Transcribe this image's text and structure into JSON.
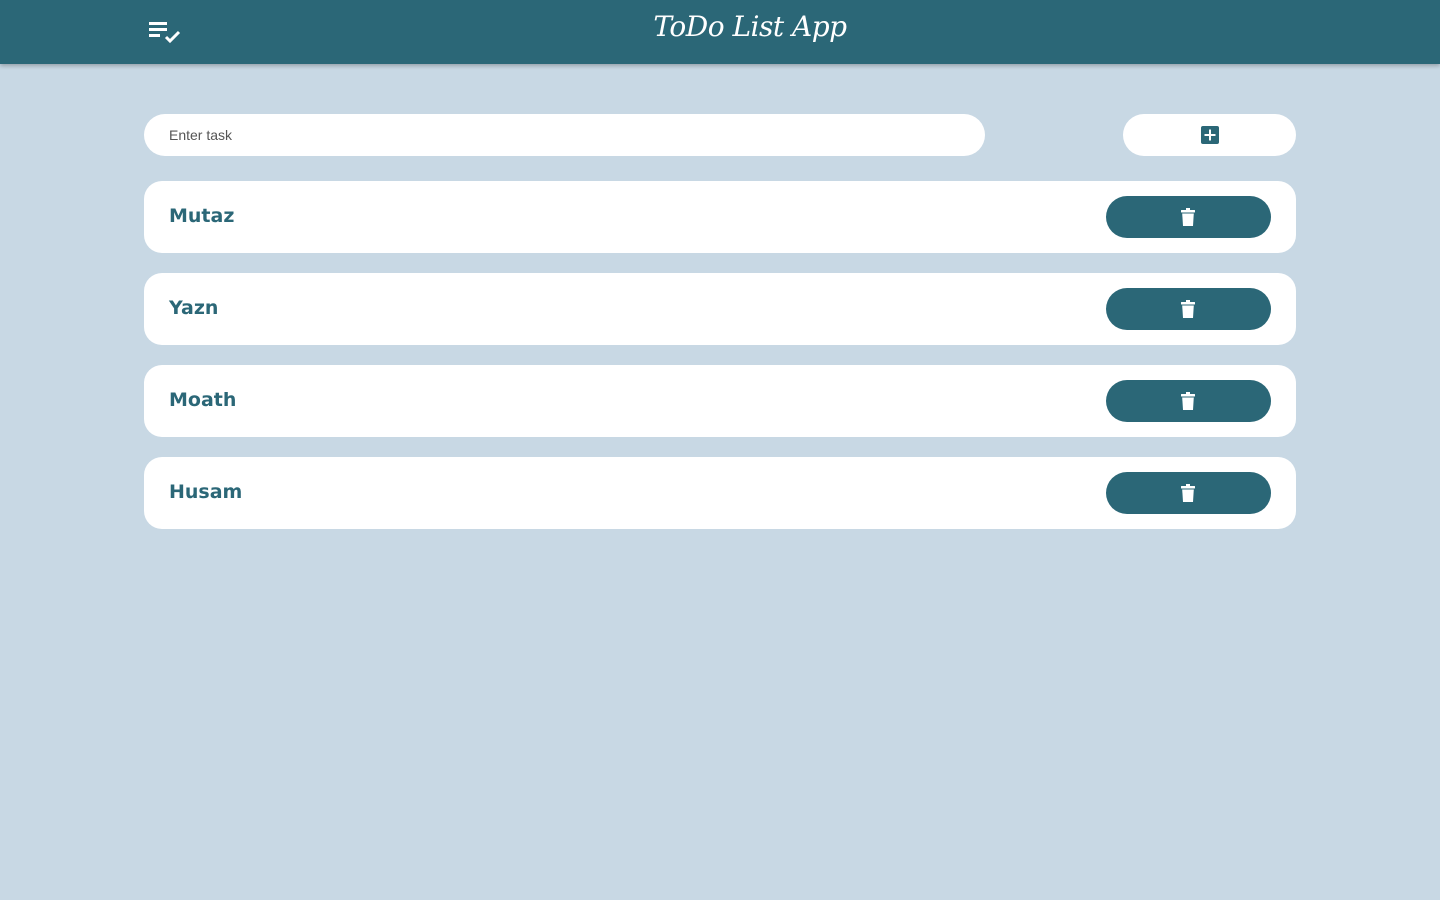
{
  "header": {
    "title": "ToDo List App",
    "logo_icon": "playlist-check-icon"
  },
  "input": {
    "placeholder": "Enter task",
    "value": ""
  },
  "add_button": {
    "icon": "plus-square-icon"
  },
  "tasks": [
    {
      "label": "Mutaz",
      "delete_icon": "trash-icon"
    },
    {
      "label": "Yazn",
      "delete_icon": "trash-icon"
    },
    {
      "label": "Moath",
      "delete_icon": "trash-icon"
    },
    {
      "label": "Husam",
      "delete_icon": "trash-icon"
    }
  ],
  "colors": {
    "primary": "#2b6777",
    "background": "#c8d8e4",
    "surface": "#ffffff"
  }
}
